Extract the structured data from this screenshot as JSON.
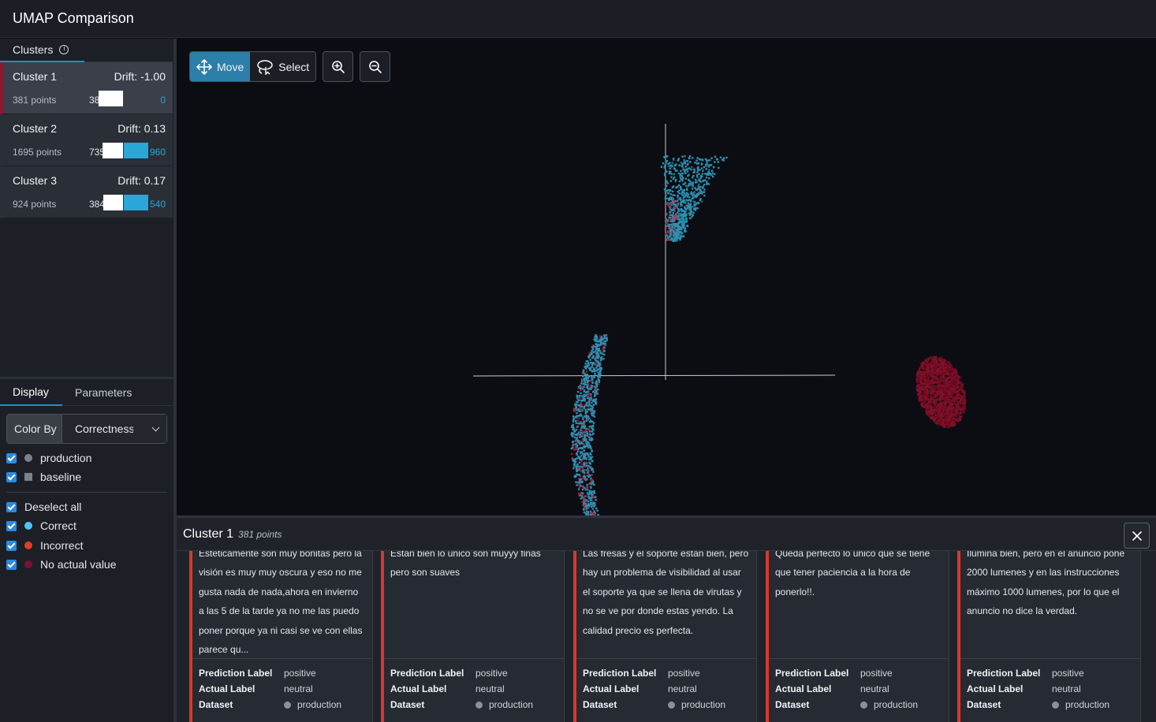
{
  "app": {
    "title": "UMAP Comparison"
  },
  "clusters_panel": {
    "tab_label": "Clusters",
    "items": [
      {
        "name": "Cluster 1",
        "drift": "Drift: -1.00",
        "points": "381 points",
        "baseline_count": "381",
        "production_count": "0",
        "baseline_fraction": 1.0,
        "production_fraction": 0.0
      },
      {
        "name": "Cluster 2",
        "drift": "Drift: 0.13",
        "points": "1695 points",
        "baseline_count": "735",
        "production_count": "960",
        "baseline_fraction": 0.434,
        "production_fraction": 0.566
      },
      {
        "name": "Cluster 3",
        "drift": "Drift: 0.17",
        "points": "924 points",
        "baseline_count": "384",
        "production_count": "540",
        "baseline_fraction": 0.416,
        "production_fraction": 0.584
      }
    ]
  },
  "display_panel": {
    "tabs": [
      "Display",
      "Parameters"
    ],
    "color_by_label": "Color By",
    "color_by_value": "Correctness",
    "datasets": [
      {
        "label": "production",
        "checked": true,
        "marker": "circle",
        "color": "#7d8189"
      },
      {
        "label": "baseline",
        "checked": true,
        "marker": "square",
        "color": "#7d8189"
      }
    ],
    "deselect_all": "Deselect all",
    "legend": [
      {
        "label": "Correct",
        "checked": true,
        "color": "#4fc3f7"
      },
      {
        "label": "Incorrect",
        "checked": true,
        "color": "#e03c28"
      },
      {
        "label": "No actual value",
        "checked": true,
        "color": "#7a1032"
      }
    ]
  },
  "toolbar": {
    "move_label": "Move",
    "select_label": "Select",
    "mode": "Move"
  },
  "details": {
    "title": "Cluster 1",
    "count": "381 points",
    "labels": {
      "prediction": "Prediction Label",
      "actual": "Actual Label",
      "dataset": "Dataset"
    },
    "cards": [
      {
        "text": "Estéticamente son muy bonitas pero la visión es muy muy oscura y eso no me gusta nada de nada,ahora en invierno a las 5 de la tarde ya no me las puedo poner porque ya ni casi se ve con ellas parece qu...",
        "prediction": "positive",
        "actual": "neutral",
        "dataset": "production"
      },
      {
        "text": "Estan bien lo unico son muyyy finas pero son suaves",
        "prediction": "positive",
        "actual": "neutral",
        "dataset": "production"
      },
      {
        "text": "Las fresas y el soporte están bien, pero hay un problema de visibilidad al usar el soporte ya que se llena de virutas y no se ve por donde estas yendo. La calidad precio es perfecta.",
        "prediction": "positive",
        "actual": "neutral",
        "dataset": "production"
      },
      {
        "text": "Queda perfecto lo único que se tiene que tener paciencia a la hora de ponerlo!!.",
        "prediction": "positive",
        "actual": "neutral",
        "dataset": "production"
      },
      {
        "text": "Ilumina bien, pero en el anuncio pone 2000 lumenes y en las instrucciones máximo 1000 lumenes, por lo que el anuncio no dice la verdad.",
        "prediction": "positive",
        "actual": "neutral",
        "dataset": "production"
      }
    ]
  }
}
